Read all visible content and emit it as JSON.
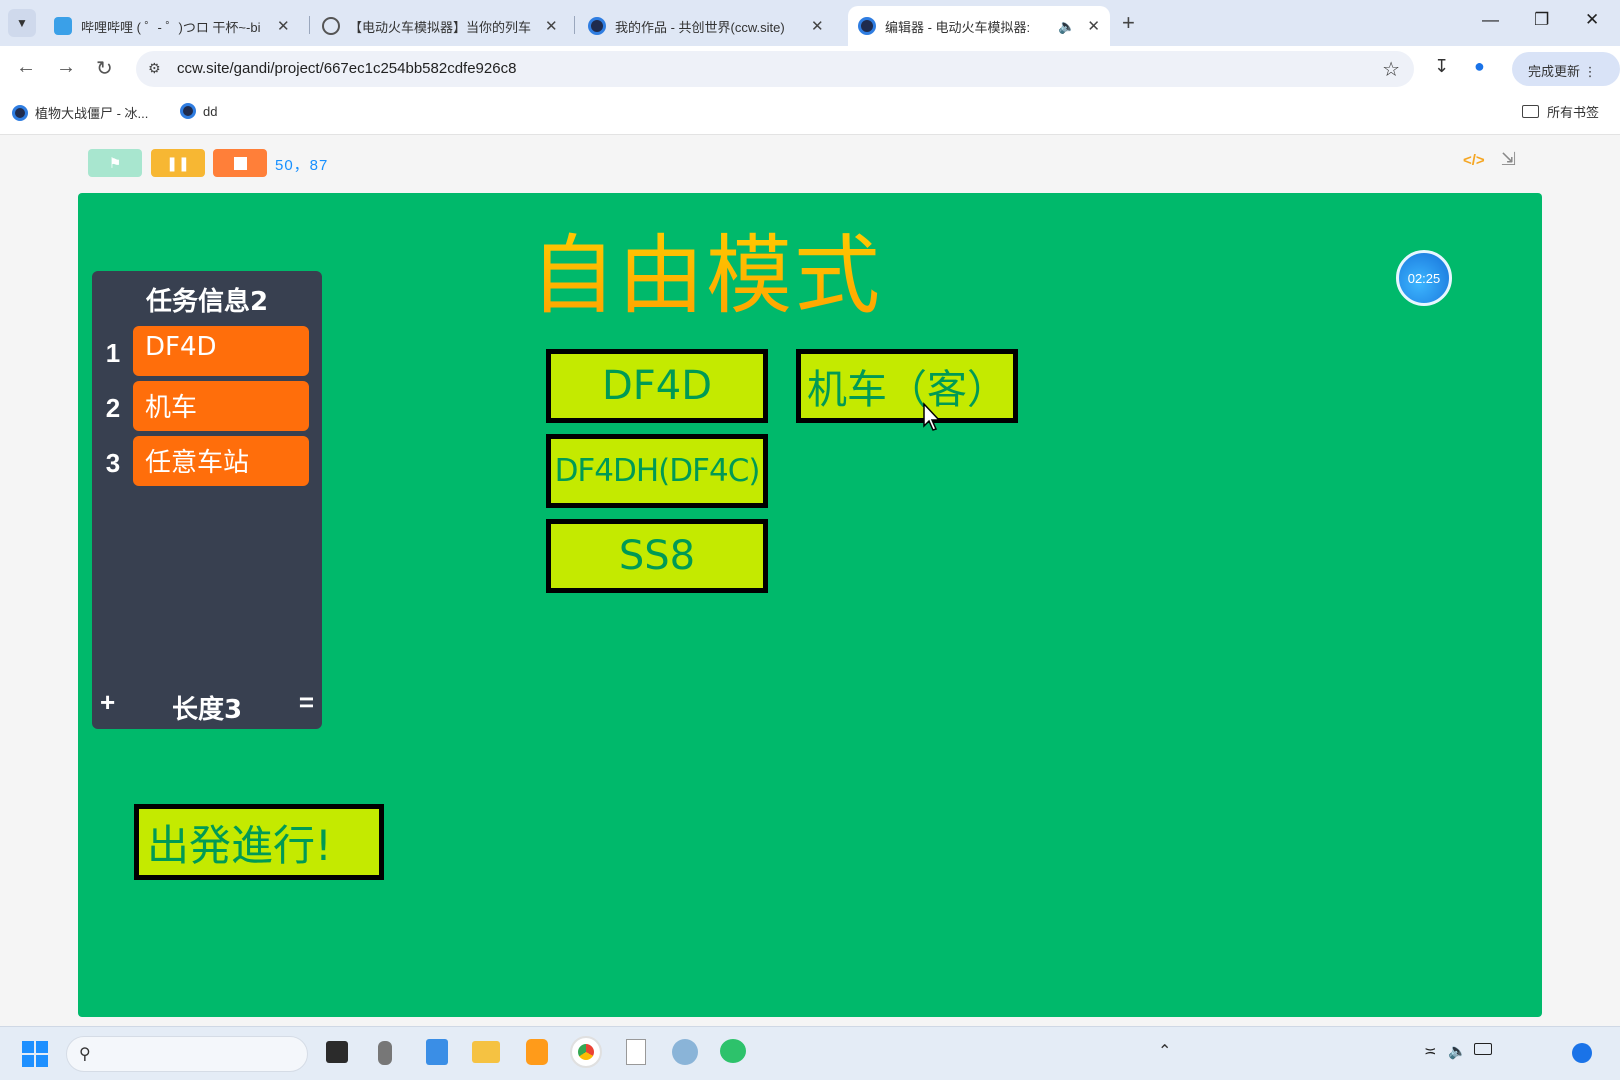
{
  "browser": {
    "tabs": [
      {
        "label": "哔哩哔哩 ( ゜- ゜)つロ 干杯~-bi",
        "icon": "bilibili-icon",
        "active": false
      },
      {
        "label": "【电动火车模拟器】当你的列车",
        "icon": "globe-icon",
        "active": false
      },
      {
        "label": "我的作品 - 共创世界(ccw.site)",
        "icon": "ccw-icon",
        "active": false
      },
      {
        "label": "编辑器 - 电动火车模拟器:",
        "icon": "ccw-icon",
        "active": true
      }
    ],
    "url": "ccw.site/gandi/project/667ec1c254bb582cdfe926c8",
    "update_label": "完成更新",
    "bookmarks": [
      {
        "label": "植物大战僵尸 - 冰..."
      },
      {
        "label": "dd"
      }
    ],
    "bookmarks_folder_label": "所有书签"
  },
  "player": {
    "coords": "50，87",
    "icons": {
      "green_flag": "flag-icon",
      "pause": "pause-icon",
      "stop": "stop-icon",
      "code": "code-icon",
      "exit_fullscreen": "shrink-icon"
    },
    "colors": {
      "flag_button": "#a8e6cf",
      "pause_button": "#f7b733",
      "stop_button": "#ff7f39",
      "stage_background": "#00b96b"
    }
  },
  "stage": {
    "title": "自由模式",
    "timer": "02:25",
    "task_list": {
      "title": "任务信息2",
      "items": [
        {
          "index": "1",
          "value": "DF4D"
        },
        {
          "index": "2",
          "value": "机车"
        },
        {
          "index": "3",
          "value": "任意车站"
        }
      ],
      "add": "+",
      "length_label": "长度3",
      "resize": "="
    },
    "buttons": {
      "df4d": "DF4D",
      "locomotive_passenger": "机车（客）",
      "df4dh": "DF4DH(DF4C)",
      "ss8": "SS8",
      "depart": "出発進行!"
    },
    "colors": {
      "sprite_button_fill": "#c4ea00",
      "sprite_button_text": "#009a55",
      "list_item_fill": "#ff6e0b"
    }
  }
}
